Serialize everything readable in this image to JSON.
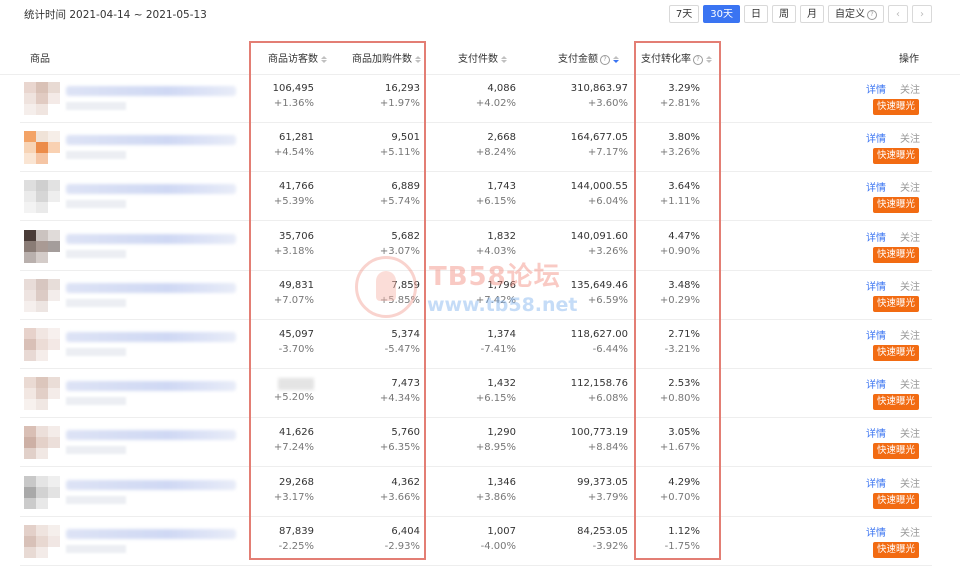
{
  "stat_time": "统计时间 2021-04-14 ~ 2021-05-13",
  "periods": [
    "7天",
    "30天",
    "日",
    "周",
    "月",
    "自定义"
  ],
  "active_period": "30天",
  "nav": {
    "prev": "‹",
    "next": "›"
  },
  "columns": {
    "product": "商品",
    "visitors": "商品访客数",
    "cart": "商品加购件数",
    "paid_items": "支付件数",
    "paid_amount": "支付金额",
    "conversion": "支付转化率",
    "actions": "操作"
  },
  "actions": {
    "detail": "详情",
    "follow": "关注",
    "expose": "快速曝光"
  },
  "rows": [
    {
      "visitors": "106,495",
      "visitors_chg": "+1.36%",
      "cart": "16,293",
      "cart_chg": "+1.97%",
      "paid_items": "4,086",
      "paid_items_chg": "+4.02%",
      "amount": "310,863.97",
      "amount_chg": "+3.60%",
      "conv": "3.29%",
      "conv_chg": "+2.81%"
    },
    {
      "visitors": "61,281",
      "visitors_chg": "+4.54%",
      "cart": "9,501",
      "cart_chg": "+5.11%",
      "paid_items": "2,668",
      "paid_items_chg": "+8.24%",
      "amount": "164,677.05",
      "amount_chg": "+7.17%",
      "conv": "3.80%",
      "conv_chg": "+3.26%"
    },
    {
      "visitors": "41,766",
      "visitors_chg": "+5.39%",
      "cart": "6,889",
      "cart_chg": "+5.74%",
      "paid_items": "1,743",
      "paid_items_chg": "+6.15%",
      "amount": "144,000.55",
      "amount_chg": "+6.04%",
      "conv": "3.64%",
      "conv_chg": "+1.11%"
    },
    {
      "visitors": "35,706",
      "visitors_chg": "+3.18%",
      "cart": "5,682",
      "cart_chg": "+3.07%",
      "paid_items": "1,832",
      "paid_items_chg": "+4.03%",
      "amount": "140,091.60",
      "amount_chg": "+3.26%",
      "conv": "4.47%",
      "conv_chg": "+0.90%"
    },
    {
      "visitors": "49,831",
      "visitors_chg": "+7.07%",
      "cart": "7,859",
      "cart_chg": "+5.85%",
      "paid_items": "1,796",
      "paid_items_chg": "+7.42%",
      "amount": "135,649.46",
      "amount_chg": "+6.59%",
      "conv": "3.48%",
      "conv_chg": "+0.29%"
    },
    {
      "visitors": "45,097",
      "visitors_chg": "-3.70%",
      "cart": "5,374",
      "cart_chg": "-5.47%",
      "paid_items": "1,374",
      "paid_items_chg": "-7.41%",
      "amount": "118,627.00",
      "amount_chg": "-6.44%",
      "conv": "2.71%",
      "conv_chg": "-3.21%"
    },
    {
      "visitors": "",
      "visitors_chg": "+5.20%",
      "cart": "7,473",
      "cart_chg": "+4.34%",
      "paid_items": "1,432",
      "paid_items_chg": "+6.15%",
      "amount": "112,158.76",
      "amount_chg": "+6.08%",
      "conv": "2.53%",
      "conv_chg": "+0.80%"
    },
    {
      "visitors": "41,626",
      "visitors_chg": "+7.24%",
      "cart": "5,760",
      "cart_chg": "+6.35%",
      "paid_items": "1,290",
      "paid_items_chg": "+8.95%",
      "amount": "100,773.19",
      "amount_chg": "+8.84%",
      "conv": "3.05%",
      "conv_chg": "+1.67%"
    },
    {
      "visitors": "29,268",
      "visitors_chg": "+3.17%",
      "cart": "4,362",
      "cart_chg": "+3.66%",
      "paid_items": "1,346",
      "paid_items_chg": "+3.86%",
      "amount": "99,373.05",
      "amount_chg": "+3.79%",
      "conv": "4.29%",
      "conv_chg": "+0.70%"
    },
    {
      "visitors": "87,839",
      "visitors_chg": "-2.25%",
      "cart": "6,404",
      "cart_chg": "-2.93%",
      "paid_items": "1,007",
      "paid_items_chg": "-4.00%",
      "amount": "84,253.05",
      "amount_chg": "-3.92%",
      "conv": "1.12%",
      "conv_chg": "-1.75%"
    }
  ],
  "thumb_colors": [
    [
      "#e9d6cf",
      "#d9c1b6",
      "#efe3de",
      "#e1cbc2"
    ],
    [
      "#f3a366",
      "#f0e3d8",
      "#f7d4b6",
      "#ec8c4a"
    ],
    [
      "#dedede",
      "#cfcfcf",
      "#ebebeb",
      "#d6d6d6"
    ],
    [
      "#4a3c38",
      "#cbc3c0",
      "#8a7c76",
      "#a99a94"
    ],
    [
      "#e8dcd8",
      "#d7c6c0",
      "#eee4e1",
      "#dccbc5"
    ],
    [
      "#e7d2cb",
      "#f1e6e2",
      "#d9c0b7",
      "#ecdcd6"
    ],
    [
      "#eadad3",
      "#dcc6bc",
      "#f2e7e2",
      "#e2cfc7"
    ],
    [
      "#d9bfb5",
      "#ecdfda",
      "#cdb0a5",
      "#e4d1c9"
    ],
    [
      "#c8c8c8",
      "#e4e4e4",
      "#a9a9a9",
      "#d2d2d2"
    ],
    [
      "#e3d0c9",
      "#efe4df",
      "#d8c1b8",
      "#e8d8d1"
    ]
  ],
  "watermark": {
    "title": "TB58论坛",
    "url": "www.tb58.net"
  }
}
